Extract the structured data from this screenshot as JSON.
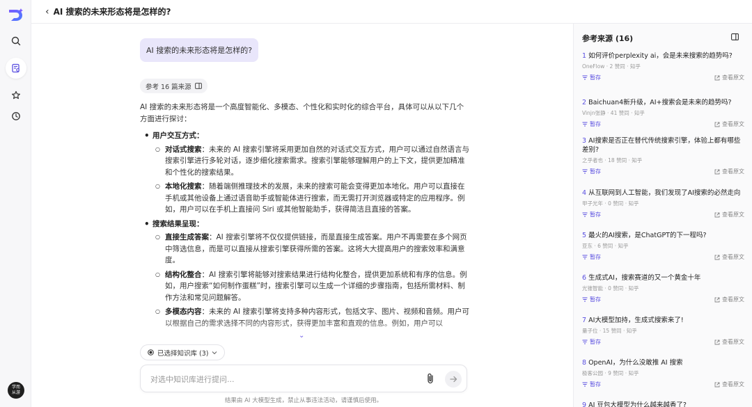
{
  "header": {
    "title": "AI 搜索的未来形态将是怎样的?"
  },
  "rail": {
    "avatar_line1": "学而",
    "avatar_line2": "从游"
  },
  "chat": {
    "user_message": "AI 搜索的未来形态将是怎样的?",
    "refs_chip": "参考 16 篇来源",
    "intro": "AI 搜索的未来形态将是一个高度智能化、多模态、个性化和实时化的综合平台，具体可以从以下几个方面进行探讨：",
    "sections": [
      {
        "heading": "用户交互方式：",
        "items": [
          {
            "term": "对话式搜索",
            "text": "：未来的 AI 搜索引擎将采用更加自然的对话式交互方式，用户可以通过自然语言与搜索引擎进行多轮对话，逐步细化搜索需求。搜索引擎能够理解用户的上下文，提供更加精准和个性化的搜索结果。"
          },
          {
            "term": "本地化搜索",
            "text": "：随着端侧推理技术的发展，未来的搜索可能会变得更加本地化。用户可以直接在手机或其他设备上通过语音助手或智能体进行搜索，而无需打开浏览器或特定的应用程序。例如，用户可以在手机上直接问 Siri 或其他智能助手，获得简洁且直接的答案。"
          }
        ]
      },
      {
        "heading": "搜索结果呈现：",
        "items": [
          {
            "term": "直接生成答案",
            "text": "：AI 搜索引擎将不仅仅提供链接，而是直接生成答案。用户不再需要在多个网页中筛选信息，而是可以直接从搜索引擎获得所需的答案。这将大大提高用户的搜索效率和满意度。"
          },
          {
            "term": "结构化整合",
            "text": "：AI 搜索引擎将能够对搜索结果进行结构化整合，提供更加系统和有序的信息。例如，用户搜索“如何制作蛋糕”时，搜索引擎可以生成一个详细的步骤指南，包括所需材料、制作方法和常见问题解答。"
          },
          {
            "term": "多模态内容",
            "text": "：未来的 AI 搜索引擎将支持多种内容形式，包括文字、图片、视频和音频。用户可以根据自己的需求选择不同的内容形式，获得更加丰富和直观的信息。例如，用户可以"
          }
        ]
      }
    ],
    "kb_chip": "已选择知识库 (3)",
    "input_placeholder": "对选中知识库进行提问...",
    "disclaimer": "结果由 AI 大模型生成，禁止从事违法活动，请谨慎后使用。"
  },
  "panel": {
    "title": "参考来源 (16)",
    "pause_label": "暂存",
    "view_label": "查看原文",
    "sources": [
      {
        "num": "1",
        "title": "如何评价perplexity ai，会是未来搜索的趋势吗?",
        "meta": "OneFlow · 2 赞同 · 知乎"
      },
      {
        "num": "2",
        "title": "Baichuan4新升级，AI+搜索会是未来的趋势吗?",
        "meta": "Vinjn张静 · 41 赞同 · 知乎"
      },
      {
        "num": "3",
        "title": "AI搜索是否正在替代传统搜索引擎，体验上都有哪些差别?",
        "meta": "之乎者也 · 18 赞同 · 知乎"
      },
      {
        "num": "4",
        "title": "从互联网到人工智能，我们发现了AI搜索的必然走向",
        "meta": "甲子光年 · 0 赞同 · 知乎"
      },
      {
        "num": "5",
        "title": "最火的AI搜索，是ChatGPT的下一程吗?",
        "meta": "亚东 · 6 赞同 · 知乎"
      },
      {
        "num": "6",
        "title": "生成式AI，搜索赛道的又一个黄金十年",
        "meta": "光锥智能 · 0 赞同 · 知乎"
      },
      {
        "num": "7",
        "title": "AI大模型加持，生成式搜索来了!",
        "meta": "量子位 · 15 赞同 · 知乎"
      },
      {
        "num": "8",
        "title": "OpenAI，为什么没敢推 AI 搜索",
        "meta": "极客公园 · 9 赞同 · 知乎"
      },
      {
        "num": "9",
        "title": "AI 豆包大模型为什么越来越香了?",
        "meta": ""
      }
    ]
  },
  "colors": {
    "accent": "#5a4fe0",
    "user_bubble": "#e9e6fb"
  }
}
